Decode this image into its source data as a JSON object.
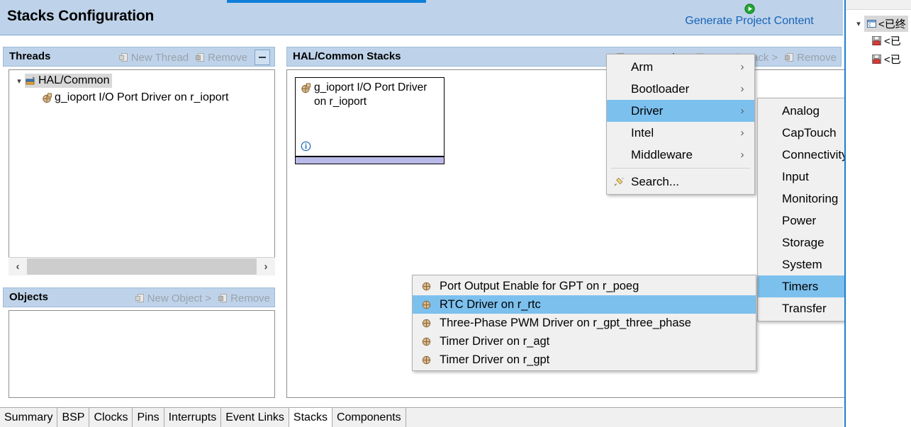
{
  "window": {
    "page_title": "Stacks Configuration",
    "generate_link": "Generate Project Content",
    "generate_icon": "play-green-icon"
  },
  "threads_panel": {
    "title": "Threads",
    "actions": [
      {
        "label": "New Thread",
        "icon": "new-thread-icon",
        "enabled": false
      },
      {
        "label": "Remove",
        "icon": "remove-icon",
        "enabled": false
      }
    ],
    "collapse_icon": "collapse-all-icon",
    "tree": [
      {
        "label": "HAL/Common",
        "icon": "thread-icon",
        "indent": 0,
        "expanded": true,
        "selected": true
      },
      {
        "label": "g_ioport I/O Port Driver on r_ioport",
        "icon": "module-icon",
        "indent": 1,
        "expanded": false,
        "selected": false
      }
    ],
    "scrollbar": {
      "left_arrow": "‹",
      "right_arrow": "›"
    }
  },
  "objects_panel": {
    "title": "Objects",
    "actions": [
      {
        "label": "New Object >",
        "icon": "new-object-icon",
        "enabled": false
      },
      {
        "label": "Remove",
        "icon": "remove-icon",
        "enabled": false
      }
    ]
  },
  "stacks_panel": {
    "title": "HAL/Common Stacks",
    "actions": [
      {
        "label": "New Stack >",
        "icon": "new-stack-icon",
        "enabled": true
      },
      {
        "label": "Extend Stack >",
        "icon": "extend-stack-icon",
        "enabled": false
      },
      {
        "label": "Remove",
        "icon": "remove-icon",
        "enabled": false
      }
    ],
    "nodes": [
      {
        "title": "g_ioport I/O Port Driver on r_ioport",
        "icon": "module-icon",
        "info_icon": "info-icon"
      }
    ]
  },
  "menu_level1": {
    "items": [
      {
        "label": "Arm",
        "submenu": true,
        "selected": false,
        "icon": ""
      },
      {
        "label": "Bootloader",
        "submenu": true,
        "selected": false,
        "icon": ""
      },
      {
        "label": "Driver",
        "submenu": true,
        "selected": true,
        "icon": ""
      },
      {
        "label": "Intel",
        "submenu": true,
        "selected": false,
        "icon": ""
      },
      {
        "label": "Middleware",
        "submenu": true,
        "selected": false,
        "icon": ""
      },
      {
        "label": "Search...",
        "submenu": false,
        "selected": false,
        "icon": "search-icon",
        "separator_before": true
      }
    ]
  },
  "menu_level2": {
    "items": [
      {
        "label": "Analog",
        "submenu": true,
        "selected": false
      },
      {
        "label": "CapTouch",
        "submenu": true,
        "selected": false
      },
      {
        "label": "Connectivity",
        "submenu": true,
        "selected": false
      },
      {
        "label": "Input",
        "submenu": true,
        "selected": false
      },
      {
        "label": "Monitoring",
        "submenu": true,
        "selected": false
      },
      {
        "label": "Power",
        "submenu": true,
        "selected": false
      },
      {
        "label": "Storage",
        "submenu": true,
        "selected": false
      },
      {
        "label": "System",
        "submenu": true,
        "selected": false
      },
      {
        "label": "Timers",
        "submenu": true,
        "selected": true
      },
      {
        "label": "Transfer",
        "submenu": true,
        "selected": false
      }
    ]
  },
  "menu_level3": {
    "items": [
      {
        "label": "Port Output Enable for GPT on r_poeg",
        "icon": "module-icon",
        "selected": false
      },
      {
        "label": "RTC Driver on r_rtc",
        "icon": "module-icon",
        "selected": true
      },
      {
        "label": "Three-Phase PWM Driver on r_gpt_three_phase",
        "icon": "module-icon",
        "selected": false
      },
      {
        "label": "Timer Driver on r_agt",
        "icon": "module-icon",
        "selected": false
      },
      {
        "label": "Timer Driver on r_gpt",
        "icon": "module-icon",
        "selected": false
      }
    ]
  },
  "right_view": {
    "rows": [
      {
        "label": "<已终",
        "icon": "c-file-icon",
        "indent": 0,
        "expanded": true,
        "selected": true
      },
      {
        "label": "<已",
        "icon": "save-icon",
        "indent": 1,
        "expanded": false,
        "selected": false
      },
      {
        "label": "<已",
        "icon": "save-icon",
        "indent": 1,
        "expanded": false,
        "selected": false
      }
    ]
  },
  "bottom_tabs": {
    "tabs": [
      {
        "label": "Summary",
        "active": false
      },
      {
        "label": "BSP",
        "active": false
      },
      {
        "label": "Clocks",
        "active": false
      },
      {
        "label": "Pins",
        "active": false
      },
      {
        "label": "Interrupts",
        "active": false
      },
      {
        "label": "Event Links",
        "active": false
      },
      {
        "label": "Stacks",
        "active": true
      },
      {
        "label": "Components",
        "active": false
      }
    ]
  },
  "colors": {
    "header_band": "#bed3ea",
    "accent_blue": "#0f7fd9",
    "link_blue": "#1763b8",
    "menu_selection": "#7cc0ee",
    "stack_bar": "#b9b9e8",
    "disabled_text": "#9aa2ab"
  }
}
